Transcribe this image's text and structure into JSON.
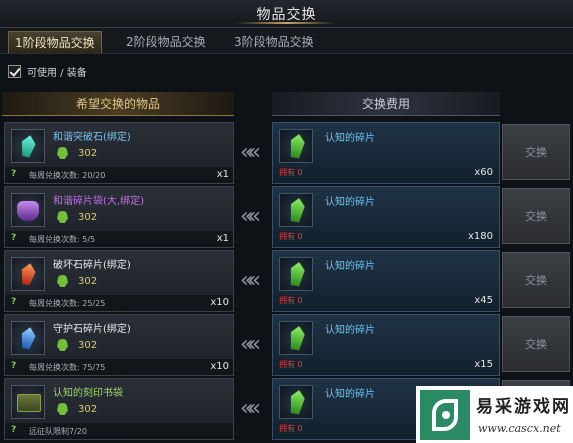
{
  "window": {
    "title": "物品交换"
  },
  "tabs": [
    {
      "label": "1阶段物品交换",
      "active": true
    },
    {
      "label": "2阶段物品交换",
      "active": false
    },
    {
      "label": "3阶段物品交换",
      "active": false
    }
  ],
  "filter": {
    "label": "可使用 / 装备",
    "checked": true
  },
  "columns": {
    "want": "希望交换的物品",
    "cost": "交换费用"
  },
  "rows": [
    {
      "name": "和谐突破石(绑定)",
      "name_color": "#6ec4f0",
      "icon": "teal-gem-icon",
      "points": "302",
      "help": "?",
      "limit": "每周兑换次数: 20/20",
      "qty": "x1",
      "cost": {
        "name": "认知的碎片",
        "own": "拥有 0",
        "qty": "x60"
      },
      "button": "交换"
    },
    {
      "name": "和谐碎片袋(大,绑定)",
      "name_color": "#c66ce8",
      "icon": "purple-bag-icon",
      "points": "302",
      "help": "?",
      "limit": "每周兑换次数: 5/5",
      "qty": "x1",
      "cost": {
        "name": "认知的碎片",
        "own": "拥有 0",
        "qty": "x180"
      },
      "button": "交换"
    },
    {
      "name": "破坏石碎片(绑定)",
      "name_color": "#e8e8e8",
      "icon": "red-gem-icon",
      "points": "302",
      "help": "?",
      "limit": "每周兑换次数: 25/25",
      "qty": "x10",
      "cost": {
        "name": "认知的碎片",
        "own": "拥有 0",
        "qty": "x45"
      },
      "button": "交换"
    },
    {
      "name": "守护石碎片(绑定)",
      "name_color": "#e8e8e8",
      "icon": "blue-gem-icon",
      "points": "302",
      "help": "?",
      "limit": "每周兑换次数: 75/75",
      "qty": "x10",
      "cost": {
        "name": "认知的碎片",
        "own": "拥有 0",
        "qty": "x15"
      },
      "button": "交换"
    },
    {
      "name": "认知的刻印书袋",
      "name_color": "#9fd66a",
      "icon": "green-book-bag-icon",
      "points": "302",
      "help": "?",
      "limit": "远征队限制7/20",
      "qty": "",
      "cost": {
        "name": "认知的碎片",
        "own": "拥有 0",
        "qty": ""
      },
      "button": "交换"
    }
  ],
  "arrows": "«",
  "watermark": {
    "name": "易采游戏网",
    "url": "www.cascx.net"
  }
}
